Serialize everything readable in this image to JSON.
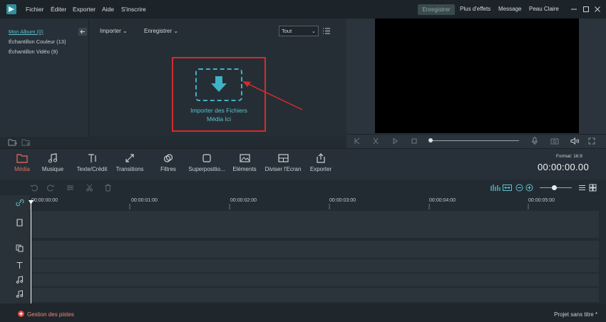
{
  "menubar": {
    "items": [
      "Fichier",
      "Éditer",
      "Exporter",
      "Aide",
      "S'inscrire"
    ],
    "register": "Enregistrer",
    "right_items": [
      "Plus d'effets",
      "Message",
      "Peau Claire"
    ]
  },
  "library": {
    "albums": [
      "Mon Album (0)",
      "Échantillon Couleur (13)",
      "Échantillon Vidéo (9)"
    ],
    "import_label": "Importer",
    "record_label": "Enregistrer",
    "filter_value": "Tout",
    "drop_line1": "Importer des Fichiers",
    "drop_line2": "Média Ici"
  },
  "toolbar": {
    "items": [
      "Média",
      "Musique",
      "Texte/Crédit",
      "Transitions",
      "Filtres",
      "Superpositio...",
      "Eléments",
      "Diviser l'Ecran",
      "Exporter"
    ],
    "active": "Média",
    "format": "Format: 16:9",
    "timecode": "00:00:00.00"
  },
  "timeline": {
    "ticks": [
      "00:00:00:00",
      "00:00:01:00",
      "00:00:02:00",
      "00:00:03:00",
      "00:00:04:00",
      "00:00:05:00"
    ]
  },
  "footer": {
    "manage_tracks": "Gestion des pistes",
    "project": "Projet sans titre *"
  },
  "colors": {
    "accent": "#3fb2c6",
    "active_tab": "#e86c5a",
    "highlight_box": "#d52b2b"
  }
}
